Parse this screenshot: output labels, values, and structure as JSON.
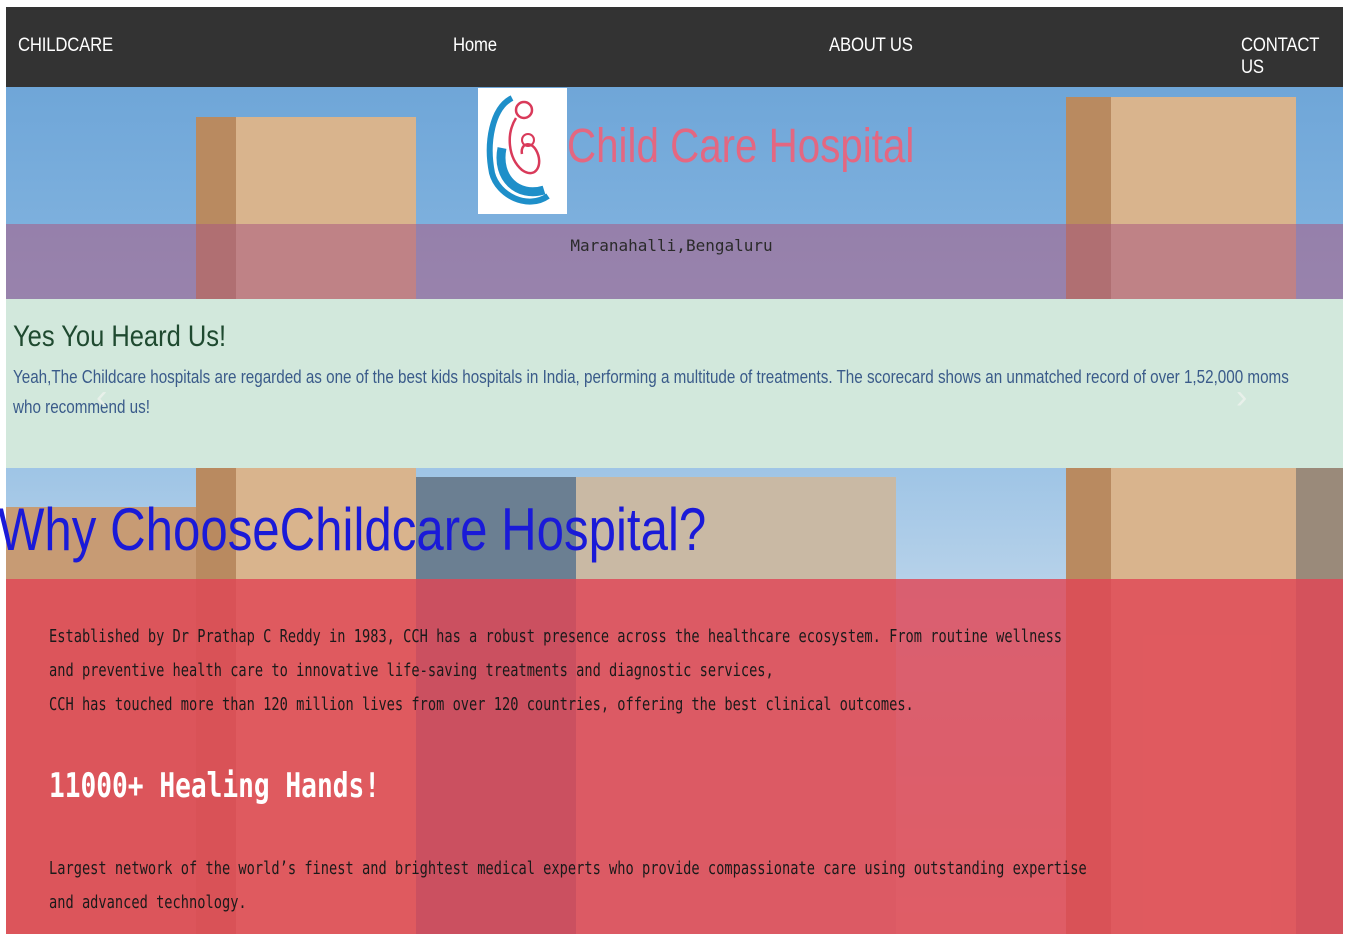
{
  "nav": {
    "brand": "CHILDCARE",
    "home": "Home",
    "about": "ABOUT US",
    "contact": "CONTACT US"
  },
  "header": {
    "hospital_name": "Child Care Hospital",
    "location": "Maranahalli,Bengaluru"
  },
  "carousel": {
    "title": "Yes You Heard Us!",
    "body": "Yeah,The Childcare hospitals are regarded as one of the best kids hospitals in India, performing a multitude of treatments. The scorecard shows an unmatched record of over 1,52,000 moms who recommend us!",
    "prev_glyph": "‹",
    "next_glyph": "›"
  },
  "why": {
    "heading": "Why ChooseChildcare Hospital?",
    "paragraph_lines": [
      "Established by Dr Prathap C Reddy in 1983, CCH has a robust presence across the healthcare ecosystem. From routine wellness",
      "and preventive health care to innovative life-saving treatments and diagnostic services,",
      "CCH has touched more than 120 million lives from over 120 countries, offering the best clinical outcomes."
    ],
    "subheading": "11000+ Healing Hands!",
    "network_lines": [
      "Largest network of the world’s finest and brightest medical experts who provide compassionate care using outstanding expertise",
      "and advanced technology."
    ]
  },
  "colors": {
    "nav_bg": "#333333",
    "brand_pink": "#f06078",
    "why_blue": "#1a1ad8",
    "red_overlay": "#e14655",
    "mint_band": "#d2e8dc"
  }
}
